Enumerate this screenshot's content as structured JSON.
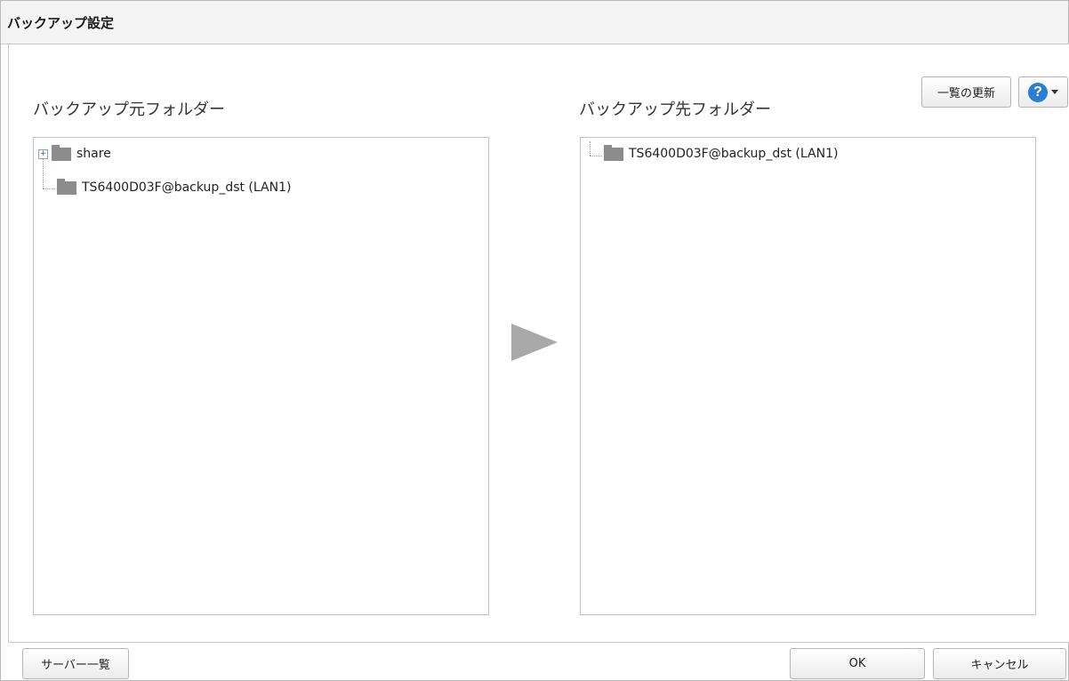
{
  "dialog": {
    "title": "バックアップ設定"
  },
  "toolbar": {
    "refresh_label": "一覧の更新",
    "help_icon_glyph": "?"
  },
  "source": {
    "label": "バックアップ元フォルダー",
    "items": [
      {
        "label": "share",
        "expandable": true
      },
      {
        "label": "TS6400D03F@backup_dst (LAN1)",
        "expandable": false
      }
    ]
  },
  "destination": {
    "label": "バックアップ先フォルダー",
    "items": [
      {
        "label": "TS6400D03F@backup_dst (LAN1)",
        "expandable": false
      }
    ]
  },
  "footer": {
    "server_list_label": "サーバー一覧",
    "ok_label": "OK",
    "cancel_label": "キャンセル"
  },
  "colors": {
    "folder": "#8c8c8c",
    "help_accent": "#2a7fd4",
    "arrow": "#a8a8a8"
  },
  "icons": [
    "folder-icon",
    "expand-plus-icon",
    "help-icon",
    "chevron-down-icon",
    "right-arrow-icon"
  ]
}
